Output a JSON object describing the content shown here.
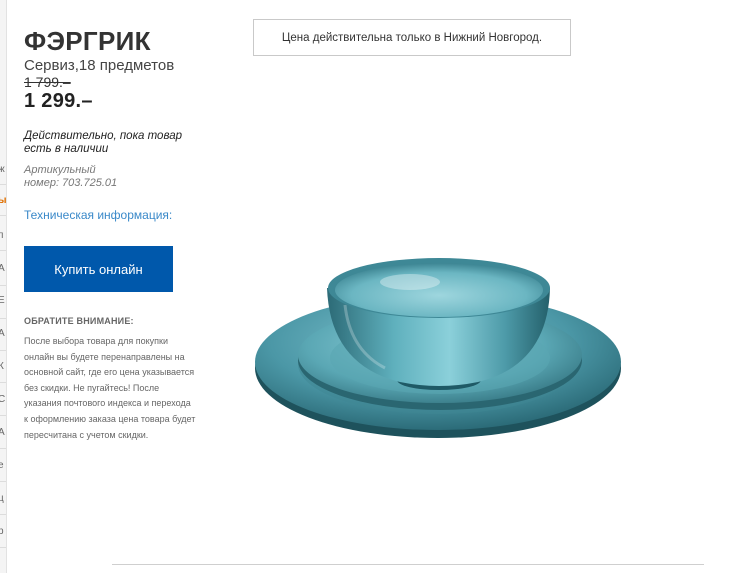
{
  "sidebar": {
    "marks": [
      "ж",
      "ы",
      "п",
      "А",
      "Е",
      "А",
      "К",
      "С",
      "А",
      "е",
      "ц",
      "р"
    ]
  },
  "product": {
    "name": "ФЭРГРИК",
    "type": "Сервиз,18 предметов",
    "old_price": "1 799.–",
    "new_price": "1 299.–",
    "availability": "Действительно, пока товар есть в наличии",
    "article_label": "Артикульный",
    "article_number": "номер: 703.725.01",
    "tech_info_link": "Техническая информация:",
    "buy_button": "Купить онлайн"
  },
  "notice": {
    "title": "ОБРАТИТЕ ВНИМАНИЕ:",
    "body": "После выбора товара для покупки онлайн вы будете перенаправлены на основной сайт, где его цена указывается без скидки. Не пугайтесь! После указания почтового индекса и перехода к оформлению заказа цена товара будет пересчитана с учетом скидки."
  },
  "price_note": "Цена действительна только в Нижний Новгород.",
  "colors": {
    "accent": "#0058ab",
    "link": "#3a89c9",
    "dish": "#4e9aa8"
  },
  "icons": {
    "product_image": "turquoise-dinnerware-set"
  }
}
